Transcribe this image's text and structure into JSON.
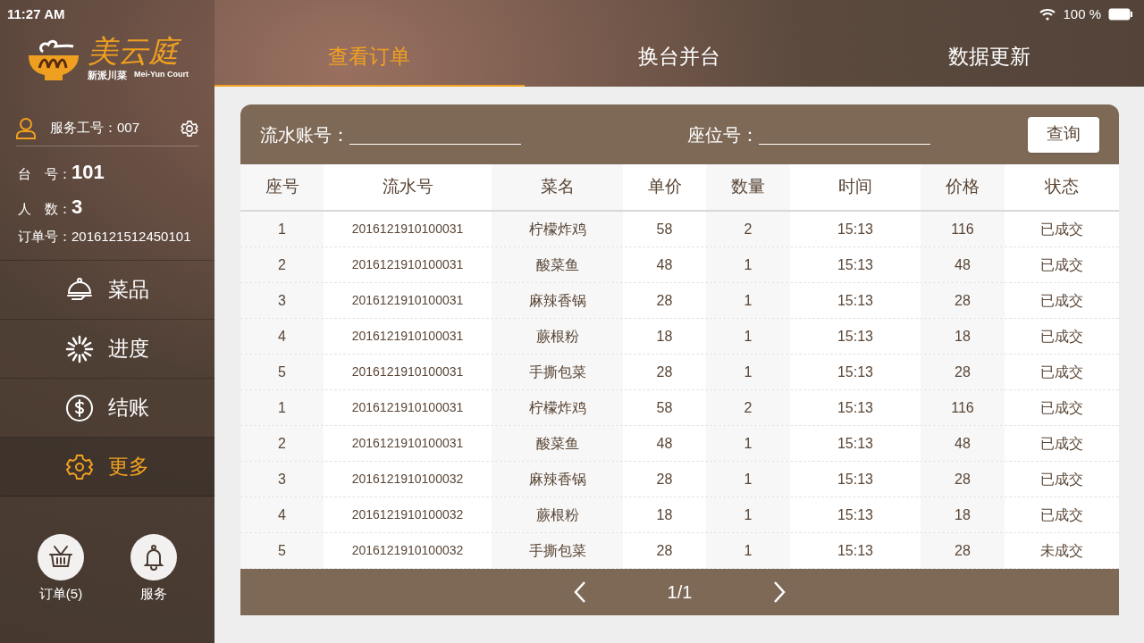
{
  "status_bar": {
    "time": "11:27 AM",
    "battery": "100 %"
  },
  "logo": {
    "name": "美云庭",
    "tagline": "新派川菜",
    "english": "Mei-Yun Court"
  },
  "staff": {
    "label": "服务工号：",
    "value": "007"
  },
  "info": [
    {
      "label": "台　号：",
      "value": "101",
      "kind": "large"
    },
    {
      "label": "人　数：",
      "value": "3",
      "kind": "large"
    },
    {
      "label": "订单号：",
      "value": "2016121512450101",
      "kind": "small"
    }
  ],
  "sidebar": {
    "items": [
      {
        "label": "菜品",
        "kind": "cloche",
        "selected": false
      },
      {
        "label": "进度",
        "kind": "spinner",
        "selected": false
      },
      {
        "label": "结账",
        "kind": "dollar",
        "selected": false
      },
      {
        "label": "更多",
        "kind": "gear",
        "selected": true
      }
    ]
  },
  "bottom_buttons": [
    {
      "label": "订单(5)",
      "kind": "basket"
    },
    {
      "label": "服务",
      "kind": "bell"
    }
  ],
  "tabs": [
    {
      "label": "查看订单",
      "selected": true
    },
    {
      "label": "换台并台",
      "selected": false
    },
    {
      "label": "数据更新",
      "selected": false
    }
  ],
  "search": {
    "fields": [
      {
        "label": "流水账号："
      },
      {
        "label": "座位号："
      }
    ],
    "button": "查询"
  },
  "table": {
    "columns": [
      "座号",
      "流水号",
      "菜名",
      "单价",
      "数量",
      "时间",
      "价格",
      "状态"
    ],
    "rows": [
      [
        "1",
        "2016121910100031",
        "柠檬炸鸡",
        "58",
        "2",
        "15:13",
        "116",
        "已成交"
      ],
      [
        "2",
        "2016121910100031",
        "酸菜鱼",
        "48",
        "1",
        "15:13",
        "48",
        "已成交"
      ],
      [
        "3",
        "2016121910100031",
        "麻辣香锅",
        "28",
        "1",
        "15:13",
        "28",
        "已成交"
      ],
      [
        "4",
        "2016121910100031",
        "蕨根粉",
        "18",
        "1",
        "15:13",
        "18",
        "已成交"
      ],
      [
        "5",
        "2016121910100031",
        "手撕包菜",
        "28",
        "1",
        "15:13",
        "28",
        "已成交"
      ],
      [
        "1",
        "2016121910100031",
        "柠檬炸鸡",
        "58",
        "2",
        "15:13",
        "116",
        "已成交"
      ],
      [
        "2",
        "2016121910100031",
        "酸菜鱼",
        "48",
        "1",
        "15:13",
        "48",
        "已成交"
      ],
      [
        "3",
        "2016121910100032",
        "麻辣香锅",
        "28",
        "1",
        "15:13",
        "28",
        "已成交"
      ],
      [
        "4",
        "2016121910100032",
        "蕨根粉",
        "18",
        "1",
        "15:13",
        "18",
        "已成交"
      ],
      [
        "5",
        "2016121910100032",
        "手撕包菜",
        "28",
        "1",
        "15:13",
        "28",
        "未成交"
      ]
    ]
  },
  "pagination": {
    "page": "1/1"
  }
}
